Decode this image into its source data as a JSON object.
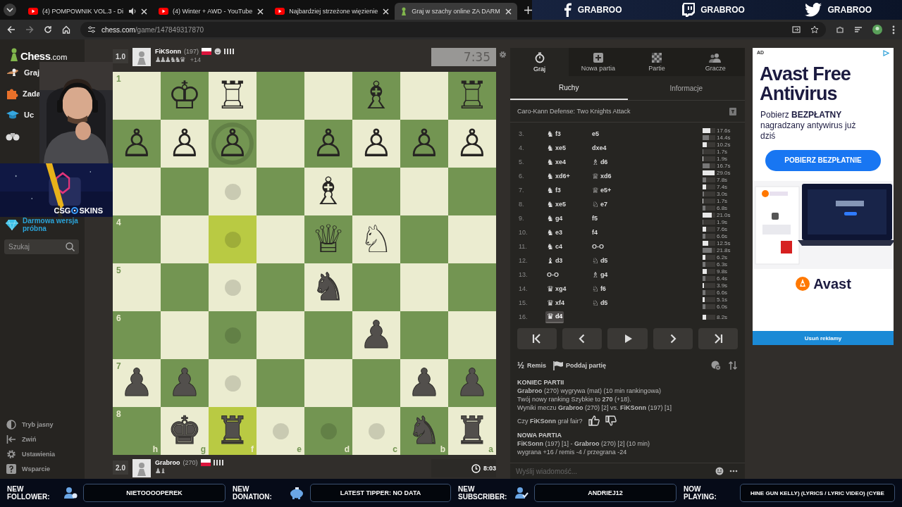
{
  "browser": {
    "tabs": [
      {
        "kind": "youtube",
        "title": "(4) POMPOWNIK VOL.3 - Di",
        "audio": true,
        "selected": false
      },
      {
        "kind": "youtube",
        "title": "(4) Winter + AWD - YouTube",
        "audio": false,
        "selected": false
      },
      {
        "kind": "youtube",
        "title": "Najbardziej strzeżone więzienie",
        "audio": false,
        "selected": false
      },
      {
        "kind": "chess",
        "title": "Graj w szachy online ZA DARM",
        "audio": false,
        "selected": true
      }
    ],
    "url": {
      "host": "chess.com",
      "path": "/game/147849317870"
    }
  },
  "stream_overlay": {
    "socials": [
      {
        "kind": "facebook",
        "handle": "GRABROO"
      },
      {
        "kind": "twitch",
        "handle": "GRABROO"
      },
      {
        "kind": "twitter",
        "handle": "GRABROO"
      }
    ],
    "banner": {
      "kind": "picture",
      "left": "CSG",
      "right": "SKINS"
    },
    "alerts": [
      {
        "kind": "follower",
        "label": "NEW FOLLOWER:",
        "value": "NIETOOOOPEREK"
      },
      {
        "kind": "donation",
        "label": "NEW DONATION:",
        "value": "LATEST TIPPER: NO DATA"
      },
      {
        "kind": "subscriber",
        "label": "NEW SUBSCRIBER:",
        "value": "ANDRIEJ12"
      },
      {
        "kind": "music",
        "label": "NOW PLAYING:",
        "value": "HINE GUN KELLY) (LYRICS / LYRIC VIDEO) (CYBE"
      }
    ]
  },
  "sidebar": {
    "logo": {
      "name": "Chess",
      "suffix": ".com"
    },
    "nav": [
      {
        "kind": "play",
        "label": "Graj"
      },
      {
        "kind": "puzzles",
        "label": "Zada"
      },
      {
        "kind": "learn",
        "label": "Uc"
      },
      {
        "kind": "watch"
      }
    ],
    "trial": "Darmowa wersja próbna",
    "search": {
      "placeholder": "Szukaj"
    },
    "footer": [
      {
        "kind": "theme",
        "label": "Tryb jasny"
      },
      {
        "kind": "collapse",
        "label": "Zwiń"
      },
      {
        "kind": "settings",
        "label": "Ustawienia"
      },
      {
        "kind": "help",
        "label": "Wsparcie"
      }
    ]
  },
  "players": [
    {
      "score": "1.0",
      "name": "FiKSonn",
      "rating": "(197)",
      "captured": "♟♟♟♞♞♛",
      "advantage": "+14",
      "clock": "7:35",
      "active": false
    },
    {
      "score": "2.0",
      "name": "Grabroo",
      "rating": "(270)",
      "captured": "♟♝",
      "clock": "8:03",
      "active": true
    }
  ],
  "board": {
    "files": [
      "h",
      "g",
      "f",
      "e",
      "d",
      "c",
      "b",
      "a"
    ],
    "ranks": [
      {
        "label": "1",
        "squares": [
          {
            "highlighted": false
          },
          {
            "piece": "♔",
            "white": true,
            "highlighted": false
          },
          {
            "piece": "♖",
            "white": true,
            "highlighted": false
          },
          {
            "highlighted": false
          },
          {
            "highlighted": false
          },
          {
            "piece": "♗",
            "white": true,
            "highlighted": false
          },
          {
            "highlighted": false
          },
          {
            "piece": "♖",
            "white": true,
            "highlighted": false
          }
        ]
      },
      {
        "squares": [
          {
            "piece": "♙",
            "white": true,
            "highlighted": false
          },
          {
            "piece": "♙",
            "white": true,
            "highlighted": false
          },
          {
            "piece": "♙",
            "white": true,
            "kind": "ring",
            "highlighted": false
          },
          {
            "highlighted": false
          },
          {
            "piece": "♙",
            "white": true,
            "highlighted": false
          },
          {
            "piece": "♙",
            "white": true,
            "highlighted": false
          },
          {
            "piece": "♙",
            "white": true,
            "highlighted": false
          },
          {
            "piece": "♙",
            "white": true,
            "highlighted": false
          }
        ]
      },
      {
        "squares": [
          {
            "highlighted": false
          },
          {
            "highlighted": false
          },
          {
            "kind": "dot",
            "highlighted": false
          },
          {
            "highlighted": false
          },
          {
            "piece": "♗",
            "white": true,
            "highlighted": false
          },
          {
            "highlighted": false
          },
          {
            "highlighted": false
          },
          {
            "highlighted": false
          }
        ]
      },
      {
        "label": "4",
        "squares": [
          {
            "highlighted": false
          },
          {
            "highlighted": false
          },
          {
            "kind": "dot",
            "highlighted": true
          },
          {
            "highlighted": false
          },
          {
            "piece": "♕",
            "white": true,
            "highlighted": false
          },
          {
            "piece": "♘",
            "white": true,
            "highlighted": false
          },
          {
            "highlighted": false
          },
          {
            "highlighted": false
          }
        ]
      },
      {
        "label": "5",
        "squares": [
          {
            "highlighted": false
          },
          {
            "highlighted": false
          },
          {
            "kind": "dot",
            "highlighted": false
          },
          {
            "highlighted": false
          },
          {
            "piece": "♞",
            "white": false,
            "highlighted": false
          },
          {
            "highlighted": false
          },
          {
            "highlighted": false
          },
          {
            "highlighted": false
          }
        ]
      },
      {
        "label": "6",
        "squares": [
          {
            "highlighted": false
          },
          {
            "highlighted": false
          },
          {
            "kind": "dot",
            "highlighted": false
          },
          {
            "highlighted": false
          },
          {
            "highlighted": false
          },
          {
            "piece": "♟",
            "white": false,
            "highlighted": false
          },
          {
            "highlighted": false
          },
          {
            "highlighted": false
          }
        ]
      },
      {
        "label": "7",
        "squares": [
          {
            "piece": "♟",
            "white": false,
            "highlighted": false
          },
          {
            "piece": "♟",
            "white": false,
            "highlighted": false
          },
          {
            "kind": "dot",
            "highlighted": false
          },
          {
            "highlighted": false
          },
          {
            "highlighted": false
          },
          {
            "highlighted": false
          },
          {
            "piece": "♟",
            "white": false,
            "highlighted": false
          },
          {
            "piece": "♟",
            "white": false,
            "highlighted": false
          }
        ]
      },
      {
        "label": "8",
        "squares": [
          {
            "highlighted": false
          },
          {
            "piece": "♚",
            "white": false,
            "highlighted": false
          },
          {
            "piece": "♜",
            "white": false,
            "highlighted": true
          },
          {
            "kind": "dot",
            "highlighted": false
          },
          {
            "kind": "dot",
            "highlighted": false
          },
          {
            "kind": "dot",
            "highlighted": false
          },
          {
            "piece": "♞",
            "white": false,
            "highlighted": false
          },
          {
            "piece": "♜",
            "white": false,
            "highlighted": false
          }
        ]
      }
    ]
  },
  "panel": {
    "tabs": [
      {
        "kind": "play",
        "label": "Graj",
        "selected": true
      },
      {
        "kind": "new",
        "label": "Nowa partia",
        "selected": false
      },
      {
        "kind": "games",
        "label": "Partie",
        "selected": false
      },
      {
        "kind": "players",
        "label": "Gracze",
        "selected": false
      }
    ],
    "subtabs": [
      {
        "label": "Ruchy",
        "selected": true
      },
      {
        "label": "Informacje",
        "selected": false
      }
    ],
    "opening": "Caro-Kann Defense: Two Knights Attack",
    "moves": [
      {
        "number": "3.",
        "white": {
          "piece": "♞",
          "san": "f3",
          "selected": false
        },
        "black": {
          "san": "e5",
          "selected": false
        },
        "times": [
          {
            "text": "17.6s",
            "level": 0.59
          },
          {
            "text": "14.4s",
            "level": 0.48
          }
        ]
      },
      {
        "number": "4.",
        "white": {
          "piece": "♞",
          "san": "xe5",
          "selected": false
        },
        "black": {
          "san": "dxe4",
          "selected": false
        },
        "times": [
          {
            "text": "10.2s",
            "level": 0.34
          },
          {
            "text": "1.7s",
            "level": 0.06
          }
        ]
      },
      {
        "number": "5.",
        "white": {
          "piece": "♞",
          "san": "xe4",
          "selected": false
        },
        "black": {
          "piece": "♗",
          "san": "d6",
          "selected": false
        },
        "times": [
          {
            "text": "1.9s",
            "level": 0.06
          },
          {
            "text": "16.7s",
            "level": 0.56
          }
        ]
      },
      {
        "number": "6.",
        "white": {
          "piece": "♞",
          "san": "xd6+",
          "selected": false
        },
        "black": {
          "piece": "♕",
          "san": "xd6",
          "selected": false
        },
        "times": [
          {
            "text": "29.0s",
            "level": 0.97
          },
          {
            "text": "7.8s",
            "level": 0.26
          }
        ]
      },
      {
        "number": "7.",
        "white": {
          "piece": "♞",
          "san": "f3",
          "selected": false
        },
        "black": {
          "piece": "♕",
          "san": "e5+",
          "selected": false
        },
        "times": [
          {
            "text": "7.4s",
            "level": 0.25
          },
          {
            "text": "3.0s",
            "level": 0.1
          }
        ]
      },
      {
        "number": "8.",
        "white": {
          "piece": "♞",
          "san": "xe5",
          "selected": false
        },
        "black": {
          "piece": "♘",
          "san": "e7",
          "selected": false
        },
        "times": [
          {
            "text": "1.7s",
            "level": 0.06
          },
          {
            "text": "6.8s",
            "level": 0.23
          }
        ]
      },
      {
        "number": "9.",
        "white": {
          "piece": "♞",
          "san": "g4",
          "selected": false
        },
        "black": {
          "san": "f5",
          "selected": false
        },
        "times": [
          {
            "text": "21.0s",
            "level": 0.7
          },
          {
            "text": "1.9s",
            "level": 0.06
          }
        ]
      },
      {
        "number": "10.",
        "white": {
          "piece": "♞",
          "san": "e3",
          "selected": false
        },
        "black": {
          "san": "f4",
          "selected": false
        },
        "times": [
          {
            "text": "7.6s",
            "level": 0.25
          },
          {
            "text": "6.6s",
            "level": 0.22
          }
        ]
      },
      {
        "number": "11.",
        "white": {
          "piece": "♞",
          "san": "c4",
          "selected": false
        },
        "black": {
          "san": "O-O",
          "selected": false
        },
        "times": [
          {
            "text": "12.5s",
            "level": 0.42
          },
          {
            "text": "21.8s",
            "level": 0.73
          }
        ]
      },
      {
        "number": "12.",
        "white": {
          "piece": "♝",
          "san": "d3",
          "selected": false
        },
        "black": {
          "piece": "♘",
          "san": "d5",
          "selected": false
        },
        "times": [
          {
            "text": "6.2s",
            "level": 0.21
          },
          {
            "text": "6.3s",
            "level": 0.21
          }
        ]
      },
      {
        "number": "13.",
        "white": {
          "san": "O-O",
          "selected": false
        },
        "black": {
          "piece": "♗",
          "san": "g4",
          "selected": false
        },
        "times": [
          {
            "text": "9.8s",
            "level": 0.33
          },
          {
            "text": "6.4s",
            "level": 0.21
          }
        ]
      },
      {
        "number": "14.",
        "white": {
          "piece": "♛",
          "san": "xg4",
          "selected": false
        },
        "black": {
          "piece": "♘",
          "san": "f6",
          "selected": false
        },
        "times": [
          {
            "text": "3.9s",
            "level": 0.13
          },
          {
            "text": "6.6s",
            "level": 0.22
          }
        ]
      },
      {
        "number": "15.",
        "white": {
          "piece": "♛",
          "san": "xf4",
          "selected": false
        },
        "black": {
          "piece": "♘",
          "san": "d5",
          "selected": false
        },
        "times": [
          {
            "text": "5.1s",
            "level": 0.17
          },
          {
            "text": "6.0s",
            "level": 0.2
          }
        ]
      },
      {
        "number": "16.",
        "white": {
          "piece": "♛",
          "san": "d4",
          "selected": true
        },
        "times": [
          {
            "text": "8.2s",
            "level": 0.27
          }
        ]
      }
    ],
    "controls": [
      {
        "kind": "first"
      },
      {
        "kind": "prev"
      },
      {
        "kind": "play"
      },
      {
        "kind": "next"
      },
      {
        "kind": "last"
      }
    ],
    "actions": [
      {
        "kind": "draw",
        "glyph": "½",
        "label": "Remis"
      },
      {
        "kind": "resign",
        "label": "Poddaj partię"
      }
    ],
    "chat": {
      "lines": [
        {
          "kind": "heading",
          "text": "KONIEC PARTII"
        },
        {
          "kind": "text",
          "text": "**Grabroo** (270) wygrywa (mat) (10 min rankingowa)"
        },
        {
          "kind": "text",
          "text": "Twój nowy ranking Szybkie to **270** (+18)."
        },
        {
          "kind": "text",
          "text": "Wyniki meczu **Grabroo** (270) [2] vs. **FiKSonn** (197) [1]"
        },
        {
          "kind": "fair",
          "text": "Czy **FiKSonn** grał fair?"
        },
        {
          "kind": "heading",
          "text": "NOWA PARTIA"
        },
        {
          "kind": "text",
          "text": "**FiKSonn** (197) [1] - **Grabroo** (270) [2] (10 min)"
        },
        {
          "kind": "text",
          "text": "wygrana +16 / remis -4 / przegrana -24"
        }
      ],
      "placeholder": "Wyślij wiadomość..."
    }
  },
  "ad": {
    "badge": "AD",
    "title": "Avast Free Antivirus",
    "body": "Pobierz **BEZPŁATNY** nagradzany antywirus już dziś",
    "button": "POBIERZ BEZPŁATNIE",
    "brand": "Avast",
    "remove": "Usuń reklamy"
  }
}
